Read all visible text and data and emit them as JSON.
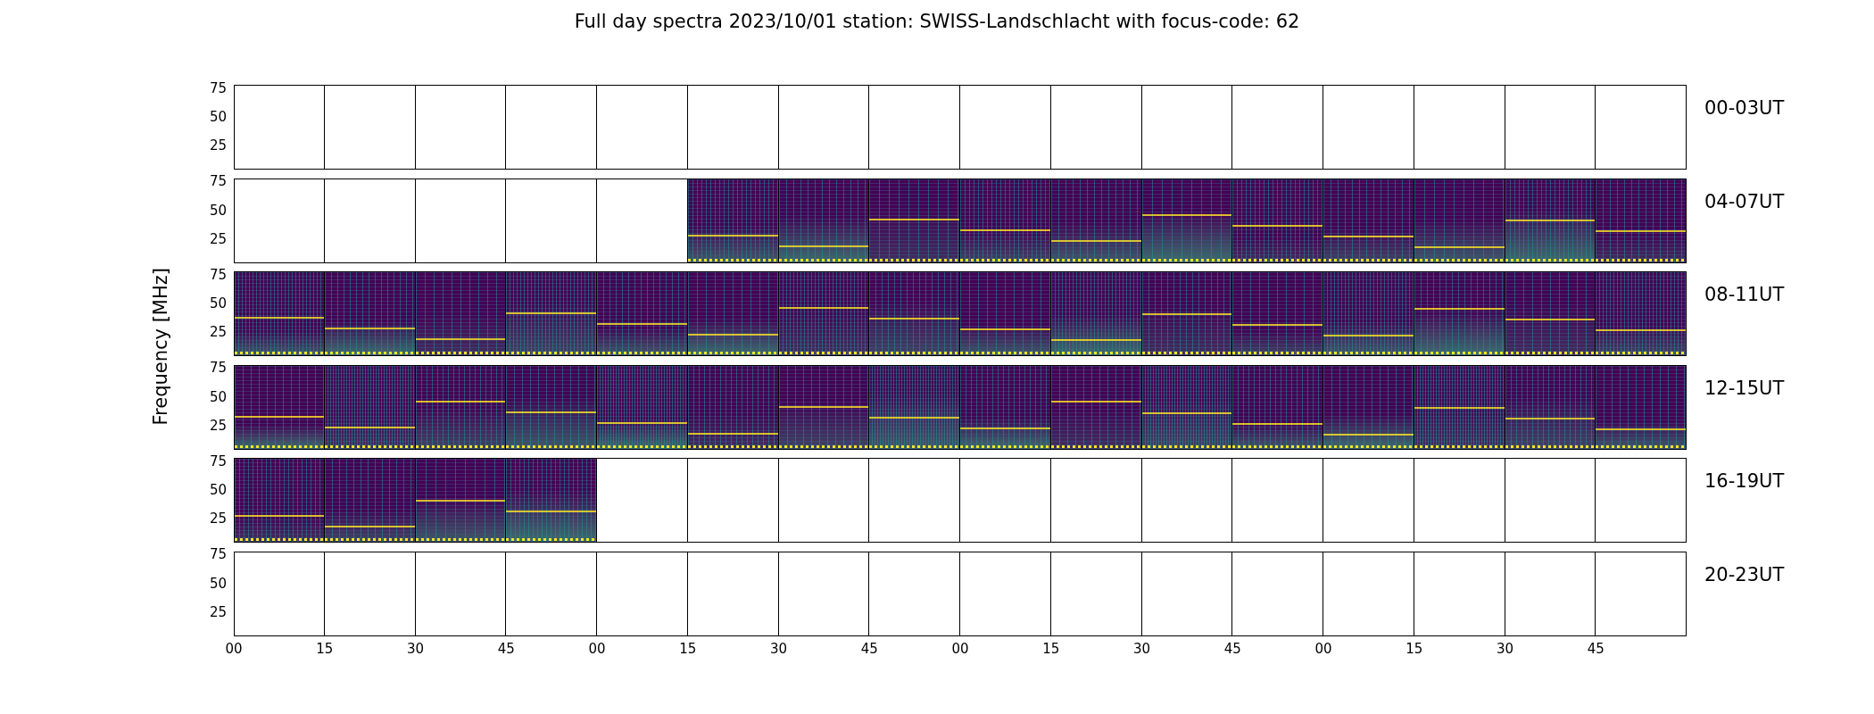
{
  "title": "Full day spectra 2023/10/01 station: SWISS-Landschlacht with focus-code: 62",
  "ylabel": "Frequency [MHz]",
  "xticks": [
    "00",
    "15",
    "30",
    "45",
    "00",
    "15",
    "30",
    "45",
    "00",
    "15",
    "30",
    "45",
    "00",
    "15",
    "30",
    "45"
  ],
  "rows": [
    {
      "label": "00-03UT",
      "yticks": [
        "75",
        "50",
        "25"
      ],
      "panels": [
        {
          "data": false
        },
        {
          "data": false
        },
        {
          "data": false
        },
        {
          "data": false
        },
        {
          "data": false
        },
        {
          "data": false
        },
        {
          "data": false
        },
        {
          "data": false
        },
        {
          "data": false
        },
        {
          "data": false
        },
        {
          "data": false
        },
        {
          "data": false
        },
        {
          "data": false
        },
        {
          "data": false
        },
        {
          "data": false
        },
        {
          "data": false
        }
      ]
    },
    {
      "label": "04-07UT",
      "yticks": [
        "75",
        "50",
        "25"
      ],
      "panels": [
        {
          "data": false
        },
        {
          "data": false
        },
        {
          "data": false
        },
        {
          "data": false
        },
        {
          "data": false
        },
        {
          "data": true
        },
        {
          "data": true
        },
        {
          "data": true
        },
        {
          "data": true
        },
        {
          "data": true
        },
        {
          "data": true
        },
        {
          "data": true
        },
        {
          "data": true
        },
        {
          "data": true
        },
        {
          "data": true
        },
        {
          "data": true
        }
      ]
    },
    {
      "label": "08-11UT",
      "yticks": [
        "75",
        "50",
        "25"
      ],
      "panels": [
        {
          "data": true
        },
        {
          "data": true
        },
        {
          "data": true
        },
        {
          "data": true
        },
        {
          "data": true
        },
        {
          "data": true
        },
        {
          "data": true
        },
        {
          "data": true
        },
        {
          "data": true
        },
        {
          "data": true
        },
        {
          "data": true
        },
        {
          "data": true
        },
        {
          "data": true
        },
        {
          "data": true
        },
        {
          "data": true
        },
        {
          "data": true
        }
      ]
    },
    {
      "label": "12-15UT",
      "yticks": [
        "75",
        "50",
        "25"
      ],
      "panels": [
        {
          "data": true
        },
        {
          "data": true
        },
        {
          "data": true
        },
        {
          "data": true
        },
        {
          "data": true
        },
        {
          "data": true
        },
        {
          "data": true
        },
        {
          "data": true
        },
        {
          "data": true
        },
        {
          "data": true
        },
        {
          "data": true
        },
        {
          "data": true
        },
        {
          "data": true
        },
        {
          "data": true
        },
        {
          "data": true
        },
        {
          "data": true
        }
      ]
    },
    {
      "label": "16-19UT",
      "yticks": [
        "75",
        "50",
        "25"
      ],
      "panels": [
        {
          "data": true
        },
        {
          "data": true
        },
        {
          "data": true
        },
        {
          "data": true
        },
        {
          "data": false
        },
        {
          "data": false
        },
        {
          "data": false
        },
        {
          "data": false
        },
        {
          "data": false
        },
        {
          "data": false
        },
        {
          "data": false
        },
        {
          "data": false
        },
        {
          "data": false
        },
        {
          "data": false
        },
        {
          "data": false
        },
        {
          "data": false
        }
      ]
    },
    {
      "label": "20-23UT",
      "yticks": [
        "75",
        "50",
        "25"
      ],
      "panels": [
        {
          "data": false
        },
        {
          "data": false
        },
        {
          "data": false
        },
        {
          "data": false
        },
        {
          "data": false
        },
        {
          "data": false
        },
        {
          "data": false
        },
        {
          "data": false
        },
        {
          "data": false
        },
        {
          "data": false
        },
        {
          "data": false
        },
        {
          "data": false
        },
        {
          "data": false
        },
        {
          "data": false
        },
        {
          "data": false
        },
        {
          "data": false
        }
      ]
    }
  ]
}
